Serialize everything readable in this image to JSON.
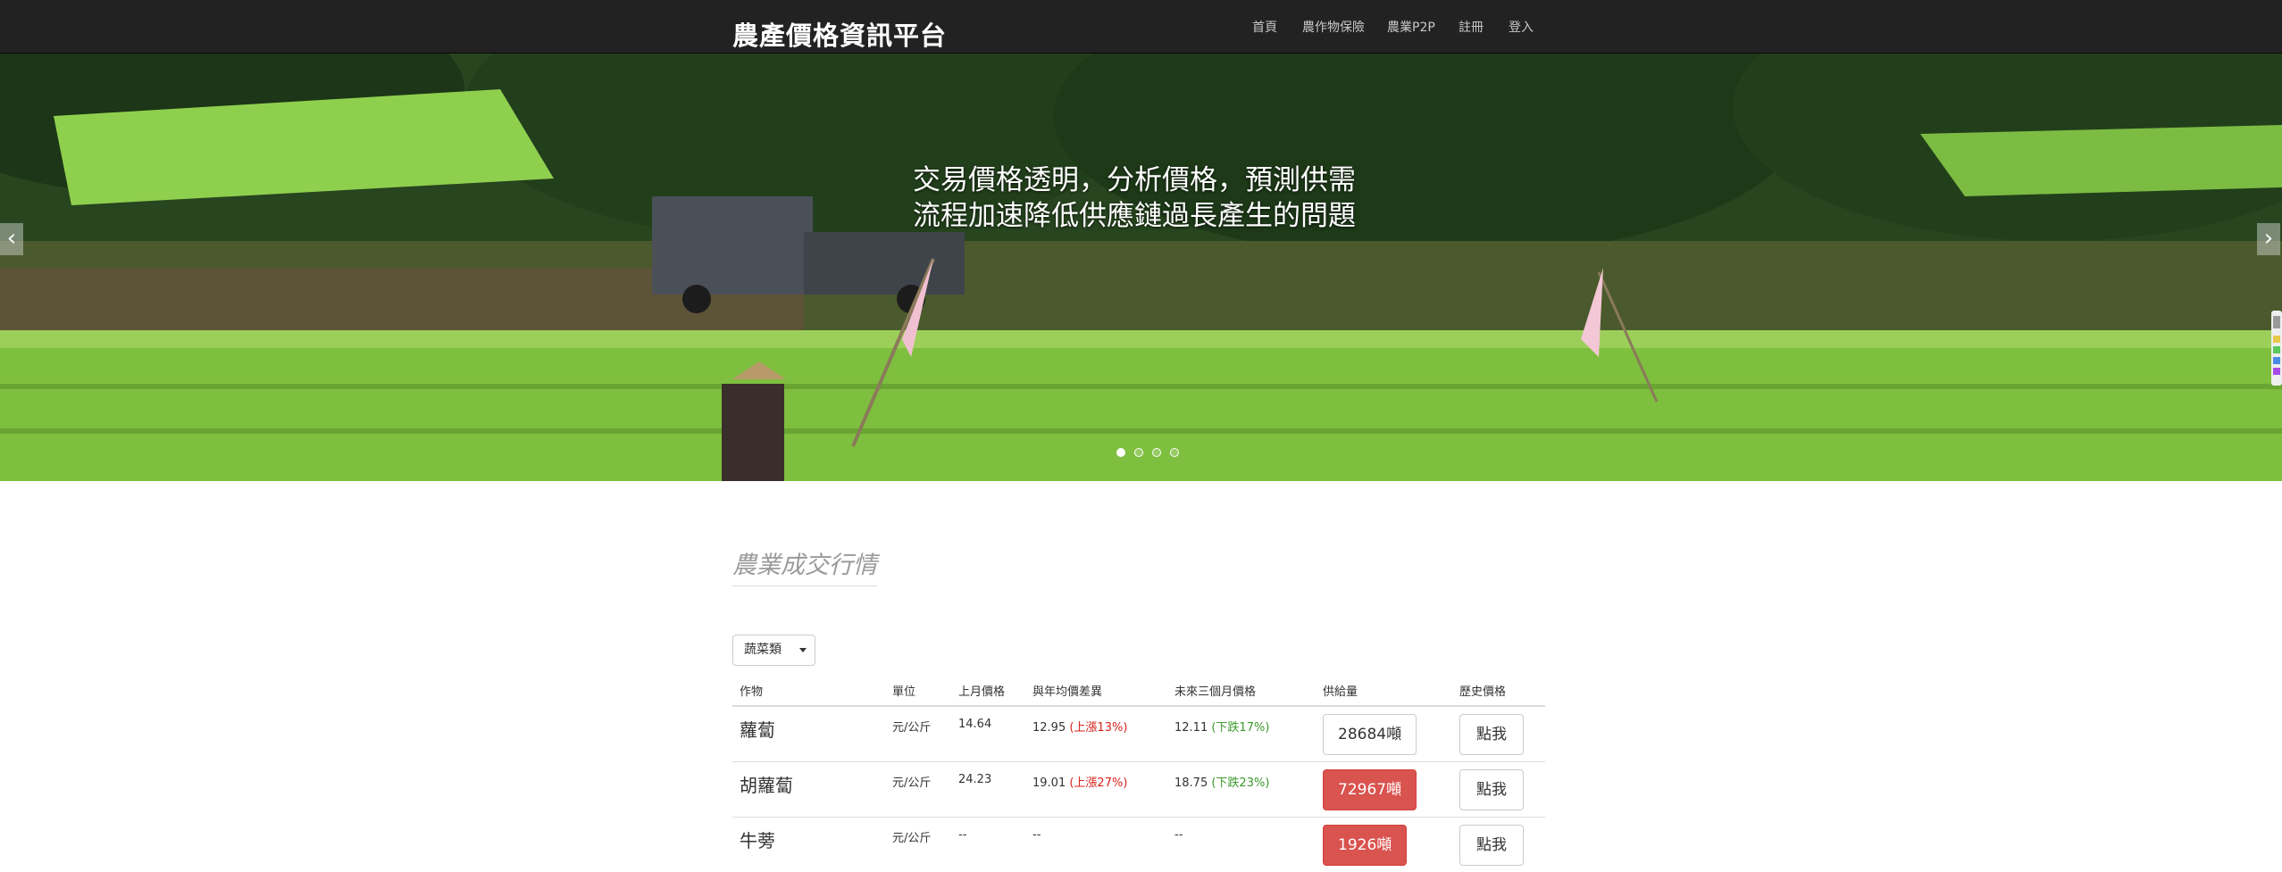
{
  "navbar": {
    "brand": "農產價格資訊平台",
    "links": [
      {
        "label": "首頁"
      },
      {
        "label": "農作物保險"
      },
      {
        "label": "農業P2P"
      },
      {
        "label": "註冊"
      },
      {
        "label": "登入"
      }
    ]
  },
  "hero": {
    "caption_line1": "交易價格透明，分析價格，預測供需",
    "caption_line2": "流程加速降低供應鏈過長產生的問題",
    "prev_symbol": "‹",
    "next_symbol": "›",
    "indicator_count": 4,
    "active_indicator": 1
  },
  "section": {
    "title": "農業成交行情"
  },
  "filter": {
    "selected": "蔬菜類"
  },
  "table": {
    "headers": [
      "作物",
      "單位",
      "上月價格",
      "與年均價差異",
      "未來三個月價格",
      "供給量",
      "歷史價格"
    ],
    "rows": [
      {
        "crop": "蘿蔔",
        "unit": "元/公斤",
        "last_month": "14.64",
        "diff_value": "12.95",
        "diff_change": "(上漲13%)",
        "forecast_value": "12.11",
        "forecast_change": "(下跌17%)",
        "supply": "28684噸",
        "supply_alert": false,
        "history": "點我"
      },
      {
        "crop": "胡蘿蔔",
        "unit": "元/公斤",
        "last_month": "24.23",
        "diff_value": "19.01",
        "diff_change": "(上漲27%)",
        "forecast_value": "18.75",
        "forecast_change": "(下跌23%)",
        "supply": "72967噸",
        "supply_alert": true,
        "history": "點我"
      },
      {
        "crop": "牛蒡",
        "unit": "元/公斤",
        "last_month": "--",
        "diff_value": "--",
        "diff_change": "",
        "forecast_value": "--",
        "forecast_change": "",
        "supply": "1926噸",
        "supply_alert": true,
        "history": "點我"
      }
    ]
  },
  "colors": {
    "navbar_bg": "#222222",
    "price_up": "#d9231d",
    "price_down": "#3c9a2d",
    "alert_button": "#d9534f"
  }
}
